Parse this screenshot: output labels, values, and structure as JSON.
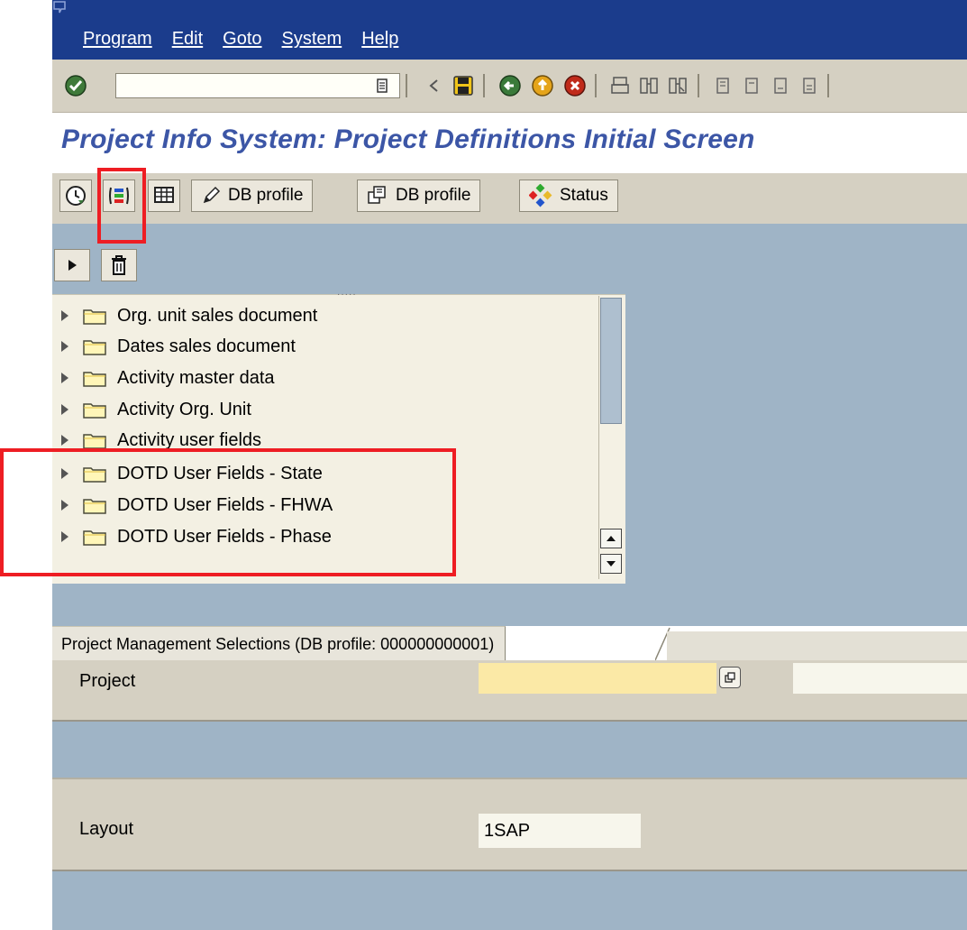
{
  "menubar": {
    "items": [
      "Program",
      "Edit",
      "Goto",
      "System",
      "Help"
    ]
  },
  "toolbar": {
    "command_field_value": "",
    "icons": [
      "enter-check-icon",
      "dropdown-icon",
      "back-arrow-icon",
      "save-icon",
      "back-icon",
      "exit-icon",
      "cancel-icon",
      "print-icon",
      "find-icon",
      "find-next-icon",
      "first-page-icon",
      "previous-page-icon",
      "next-page-icon",
      "last-page-icon"
    ]
  },
  "page": {
    "title": "Project Info System: Project Definitions Initial Screen"
  },
  "app_toolbar": {
    "db_profile_label_1": "DB profile",
    "db_profile_label_2": "DB profile",
    "status_label": "Status"
  },
  "tree": {
    "items": [
      "Org. unit sales document",
      "Dates sales document",
      "Activity master data",
      "Activity Org. Unit",
      "Activity user fields",
      "DOTD User Fields - State",
      "DOTD User Fields - FHWA",
      "DOTD User Fields - Phase"
    ]
  },
  "selections": {
    "header": "Project Management Selections (DB profile: 000000000001)",
    "project_label": "Project",
    "project_value": "",
    "layout_label": "Layout",
    "layout_value": "1SAP"
  },
  "colors": {
    "menubar": "#1b3c8c",
    "title": "#3c56a6",
    "background_blue": "#9fb4c6",
    "highlight": "#ee1d23",
    "required_field": "#fbe9a6"
  }
}
